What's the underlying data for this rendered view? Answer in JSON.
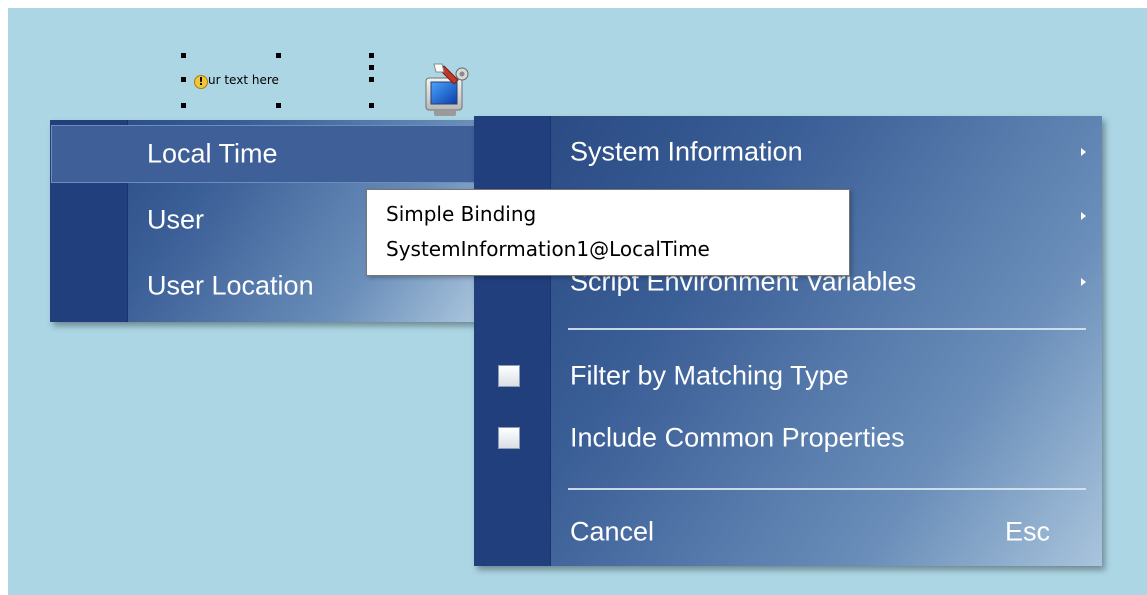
{
  "design_object": {
    "label": "ur text here"
  },
  "submenu": {
    "items": [
      {
        "label": "Local Time"
      },
      {
        "label": "User"
      },
      {
        "label": "User Location"
      }
    ]
  },
  "context_menu": {
    "items": [
      {
        "label": "System Information"
      },
      {
        "label": ""
      },
      {
        "label": "Script Environment Variables"
      }
    ],
    "options": [
      {
        "label": "Filter by Matching Type",
        "checked": false
      },
      {
        "label": "Include Common Properties",
        "checked": false
      }
    ],
    "cancel": {
      "label": "Cancel",
      "shortcut": "Esc"
    }
  },
  "tooltip": {
    "line1": "Simple Binding",
    "line2": "SystemInformation1@LocalTime"
  },
  "colors": {
    "canvas": "#acd6e4",
    "menu_gutter": "#223f7d",
    "menu_gradient_start": "#26457f",
    "menu_gradient_end": "#a9c4dc"
  },
  "icons": {
    "system_info": "computer-with-tools-icon",
    "warning": "warning-icon"
  }
}
